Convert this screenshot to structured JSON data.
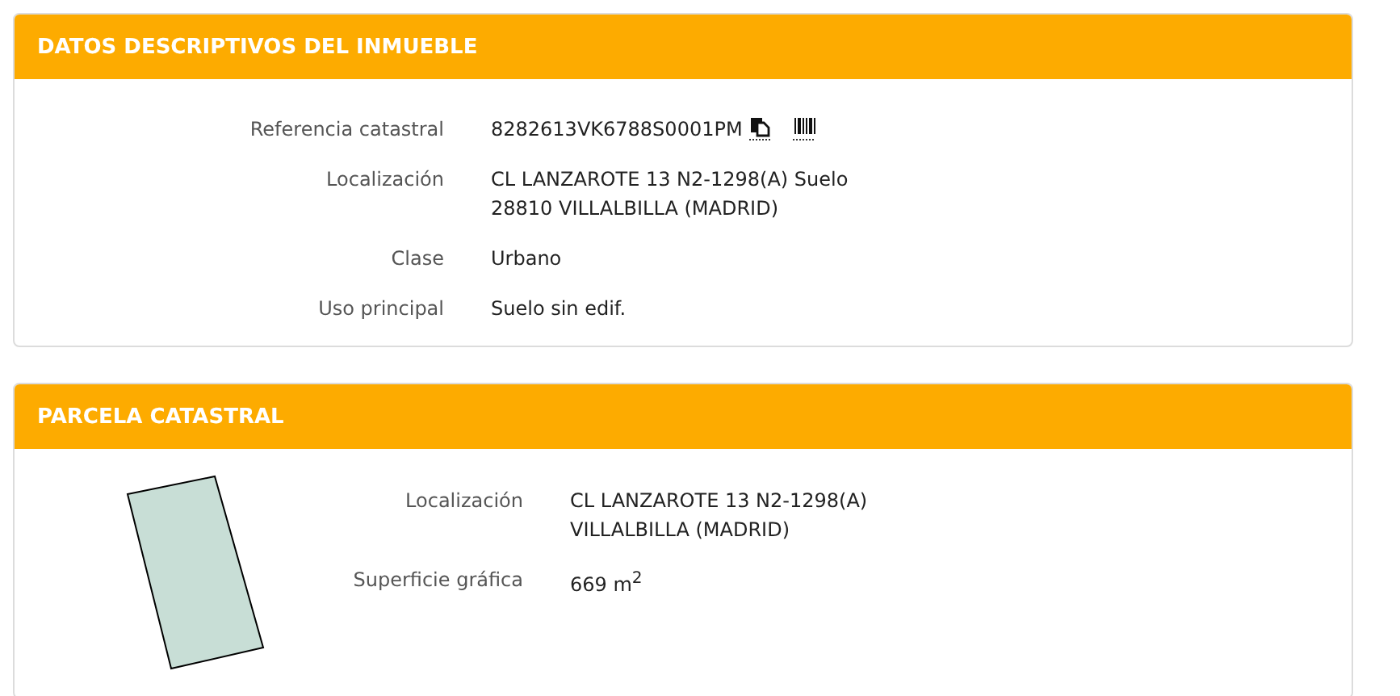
{
  "sections": [
    {
      "title": "DATOS DESCRIPTIVOS DEL INMUEBLE",
      "has_parcel_drawing": false,
      "fields": [
        {
          "label": "Referencia catastral",
          "lines": [
            "8282613VK6788S0001PM"
          ],
          "actions": [
            {
              "kind": "copy"
            },
            {
              "kind": "barcode"
            }
          ]
        },
        {
          "label": "Localización",
          "lines": [
            "CL LANZAROTE 13 N2-1298(A) Suelo",
            "28810 VILLALBILLA (MADRID)"
          ]
        },
        {
          "label": "Clase",
          "lines": [
            "Urbano"
          ]
        },
        {
          "label": "Uso principal",
          "lines": [
            "Suelo sin edif."
          ]
        }
      ]
    },
    {
      "title": "PARCELA CATASTRAL",
      "has_parcel_drawing": true,
      "fields": [
        {
          "label": "Localización",
          "lines": [
            "CL LANZAROTE 13 N2-1298(A)",
            "VILLALBILLA (MADRID)"
          ]
        },
        {
          "label": "Superficie gráfica",
          "lines": [
            "669 m$^{2}$"
          ]
        }
      ]
    }
  ]
}
